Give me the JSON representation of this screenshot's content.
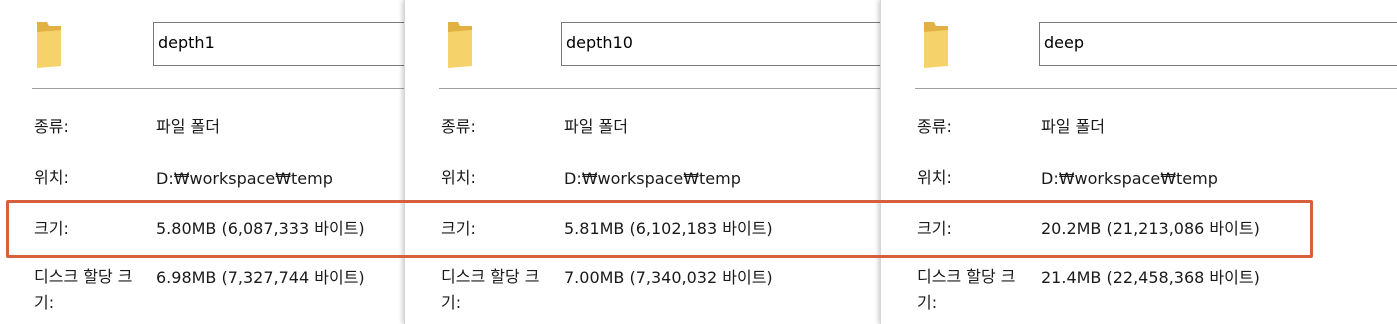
{
  "panels": [
    {
      "name": "depth1",
      "type_label": "종류:",
      "type_value": "파일 폴더",
      "location_label": "위치:",
      "location_value": "D:₩workspace₩temp",
      "size_label": "크기:",
      "size_value": "5.80MB (6,087,333 바이트)",
      "disk_label": "디스크 할당 크기:",
      "disk_value": "6.98MB (7,327,744 바이트)"
    },
    {
      "name": "depth10",
      "type_label": "종류:",
      "type_value": "파일 폴더",
      "location_label": "위치:",
      "location_value": "D:₩workspace₩temp",
      "size_label": "크기:",
      "size_value": "5.81MB (6,102,183 바이트)",
      "disk_label": "디스크 할당 크기:",
      "disk_value": "7.00MB (7,340,032 바이트)"
    },
    {
      "name": "deep",
      "type_label": "종류:",
      "type_value": "파일 폴더",
      "location_label": "위치:",
      "location_value": "D:₩workspace₩temp",
      "size_label": "크기:",
      "size_value": "20.2MB (21,213,086 바이트)",
      "disk_label": "디스크 할당 크기:",
      "disk_value": "21.4MB (22,458,368 바이트)"
    }
  ],
  "icons": {
    "folder": "folder-icon"
  },
  "colors": {
    "highlight": "#d5603b",
    "folder_front": "#f6d26b",
    "folder_back": "#e1b143"
  }
}
